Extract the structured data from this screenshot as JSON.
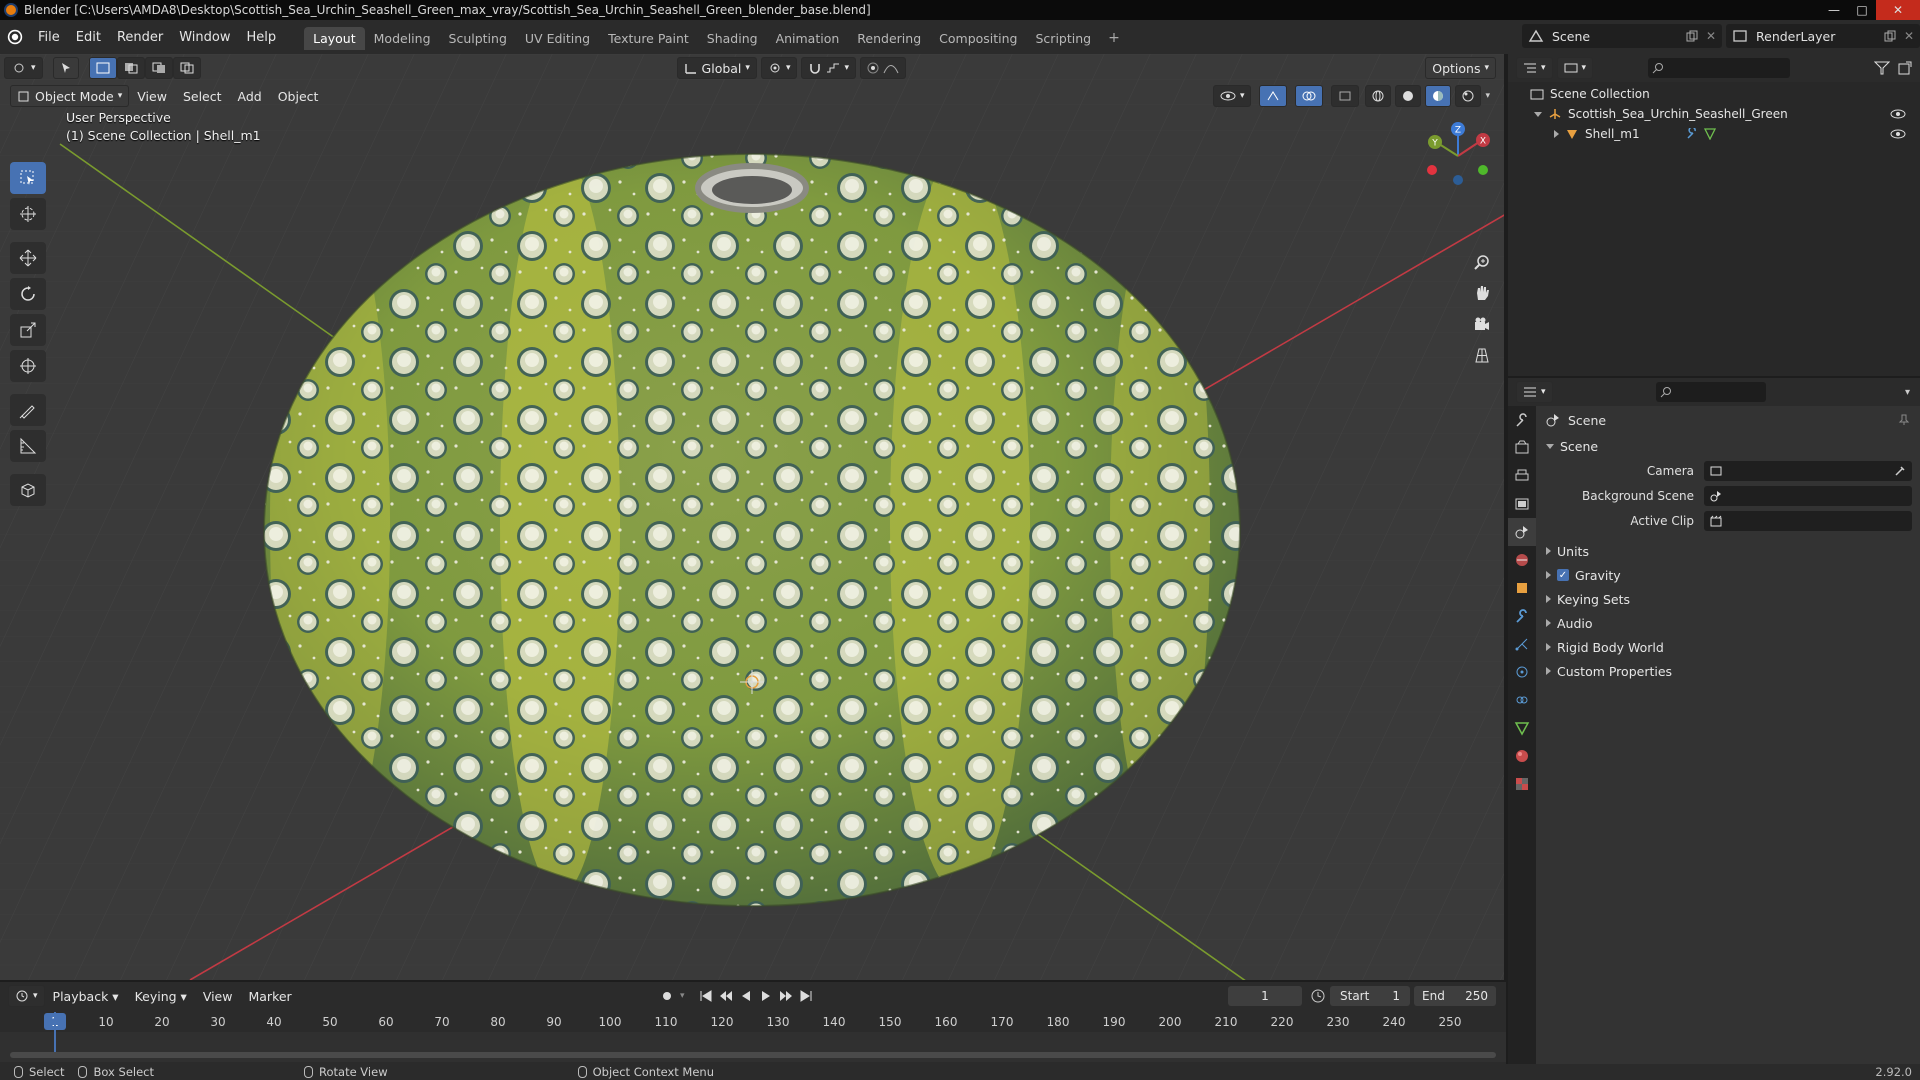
{
  "window": {
    "title": "Blender [C:\\Users\\AMDA8\\Desktop\\Scottish_Sea_Urchin_Seashell_Green_max_vray/Scottish_Sea_Urchin_Seashell_Green_blender_base.blend]"
  },
  "menu": {
    "items": [
      "File",
      "Edit",
      "Render",
      "Window",
      "Help"
    ]
  },
  "workspaces": {
    "tabs": [
      "Layout",
      "Modeling",
      "Sculpting",
      "UV Editing",
      "Texture Paint",
      "Shading",
      "Animation",
      "Rendering",
      "Compositing",
      "Scripting"
    ],
    "active": "Layout",
    "add": "+"
  },
  "scene_selector": {
    "value": "Scene"
  },
  "renderlayer_selector": {
    "value": "RenderLayer"
  },
  "viewport": {
    "orientation": "Global",
    "options_label": "Options",
    "mode": "Object Mode",
    "header_menus": [
      "View",
      "Select",
      "Add",
      "Object"
    ],
    "overlay_line1": "User Perspective",
    "overlay_line2": "(1) Scene Collection | Shell_m1",
    "gizmo_axes": {
      "x": "X",
      "y": "Y",
      "z": "Z"
    }
  },
  "timeline": {
    "menus": [
      "Playback",
      "Keying",
      "View",
      "Marker"
    ],
    "current_frame": "1",
    "start_label": "Start",
    "start_value": "1",
    "end_label": "End",
    "end_value": "250",
    "ruler": [
      "1",
      "10",
      "20",
      "30",
      "40",
      "50",
      "60",
      "70",
      "80",
      "90",
      "100",
      "110",
      "120",
      "130",
      "140",
      "150",
      "160",
      "170",
      "180",
      "190",
      "200",
      "210",
      "220",
      "230",
      "240",
      "250"
    ]
  },
  "statusbar": {
    "select": "Select",
    "box_select": "Box Select",
    "rotate_view": "Rotate View",
    "context_menu": "Object Context Menu",
    "version": "2.92.0"
  },
  "outliner": {
    "root": "Scene Collection",
    "collection": "Scottish_Sea_Urchin_Seashell_Green",
    "object": "Shell_m1"
  },
  "properties": {
    "context": "Scene",
    "panel_scene": "Scene",
    "fields": [
      {
        "label": "Camera"
      },
      {
        "label": "Background Scene"
      },
      {
        "label": "Active Clip"
      }
    ],
    "panels": [
      "Units",
      "Gravity",
      "Keying Sets",
      "Audio",
      "Rigid Body World",
      "Custom Properties"
    ]
  },
  "colors": {
    "accent": "#4772b3",
    "shell_green": "#c2c640",
    "shell_dark": "#3d5e58",
    "axis_red": "#c23a44",
    "axis_green": "#7a9b2e"
  }
}
